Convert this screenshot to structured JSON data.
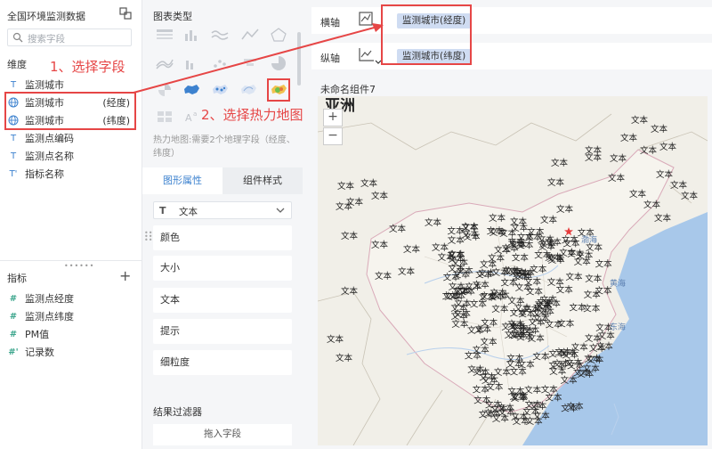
{
  "data_panel": {
    "dataset_title": "全国环境监测数据",
    "search_placeholder": "搜索字段",
    "dimension_title": "维度",
    "dimensions": [
      {
        "name": "监测城市",
        "suffix": "",
        "icon": "text-type-icon"
      },
      {
        "name": "监测城市",
        "suffix": "(经度)",
        "icon": "globe-icon"
      },
      {
        "name": "监测城市",
        "suffix": "(纬度)",
        "icon": "globe-icon"
      },
      {
        "name": "监测点编码",
        "suffix": "",
        "icon": "text-type-icon"
      },
      {
        "name": "监测点名称",
        "suffix": "",
        "icon": "text-type-icon"
      },
      {
        "name": "指标名称",
        "suffix": "",
        "icon": "text-calc-icon"
      }
    ],
    "measure_title": "指标",
    "measures": [
      {
        "name": "监测点经度",
        "icon": "number-icon"
      },
      {
        "name": "监测点纬度",
        "icon": "number-icon"
      },
      {
        "name": "PM值",
        "icon": "number-icon"
      },
      {
        "name": "记录数",
        "icon": "number-calc-icon"
      }
    ],
    "glyphs": {
      "text": "T",
      "text_calc": "T'",
      "number": "#",
      "number_calc": "#'"
    }
  },
  "config_panel": {
    "chart_type_title": "图表类型",
    "chart_type_hint": "热力地图:需要2个地理字段（经度、纬度）",
    "tabs": [
      "图形属性",
      "组件样式"
    ],
    "mark_type": "文本",
    "properties": [
      "颜色",
      "大小",
      "文本",
      "提示",
      "细粒度"
    ],
    "filter_title": "结果过滤器",
    "drop_hint": "拖入字段"
  },
  "axes": {
    "x_label": "横轴",
    "y_label": "纵轴",
    "x_field": "监测城市(经度)",
    "y_field": "监测城市(纬度)"
  },
  "widget": {
    "title": "未命名组件7",
    "zoom_in": "+",
    "zoom_out": "−",
    "map_partial_text": "亚洲",
    "marker_text": "文本",
    "sea_labels": [
      "渤海",
      "黄海",
      "东海"
    ]
  },
  "annotations": {
    "step1": "1、选择字段",
    "step2": "2、选择热力地图"
  },
  "colors": {
    "accent": "#3d82cf",
    "annotation_red": "#e64646",
    "pill_bg": "#cfdcf2",
    "panel_bg": "#f5f6f8",
    "sea": "#a8c8ea",
    "land": "#f1efe8"
  }
}
